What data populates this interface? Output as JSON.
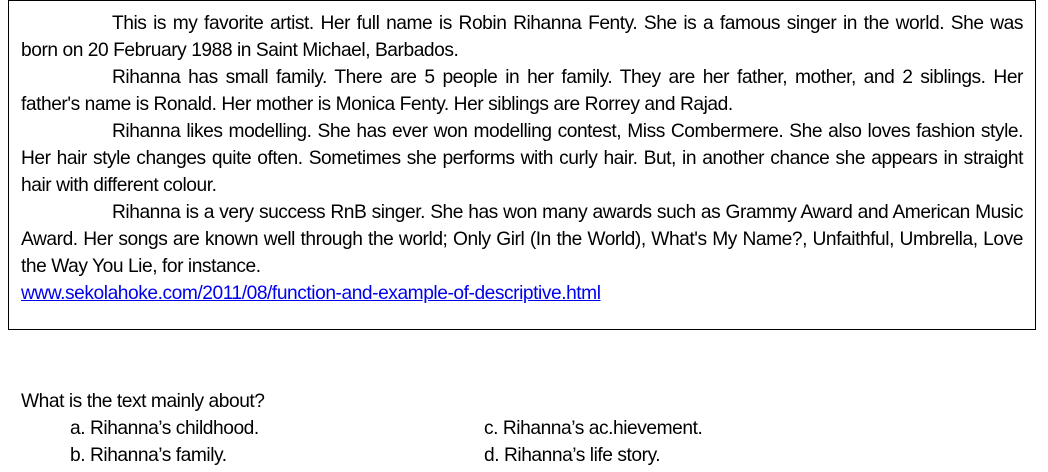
{
  "passage": {
    "paragraphs": [
      "This is my favorite artist. Her full name is Robin Rihanna Fenty. She is a famous singer in the world. She was born on 20 February 1988 in Saint Michael, Barbados.",
      "Rihanna has small family. There are 5 people in her family. They are her father, mother, and 2 siblings. Her father's name is Ronald. Her mother is Monica Fenty. Her siblings are Rorrey and Rajad.",
      "Rihanna likes modelling. She has ever won modelling contest, Miss Combermere. She also loves fashion style. Her hair style changes quite often. Sometimes she performs with curly hair. But, in another chance she appears in straight hair with different colour.",
      "Rihanna is a very success RnB singer. She has won many awards such as Grammy Award and American Music Award. Her songs are known well through the world; Only Girl (In the World), What's My Name?, Unfaithful, Umbrella, Love the Way You Lie, for instance."
    ],
    "source_link": "www.sekolahoke.com/2011/08/function-and-example-of-descriptive.html"
  },
  "question": {
    "text": "What is the text mainly about?",
    "options": [
      "a. Rihanna’s childhood.",
      "b. Rihanna’s family.",
      "c. Rihanna’s ac.hievement.",
      "d. Rihanna’s life story."
    ]
  },
  "colors": {
    "link": "#0000ee",
    "border": "#000000",
    "text": "#000000"
  }
}
